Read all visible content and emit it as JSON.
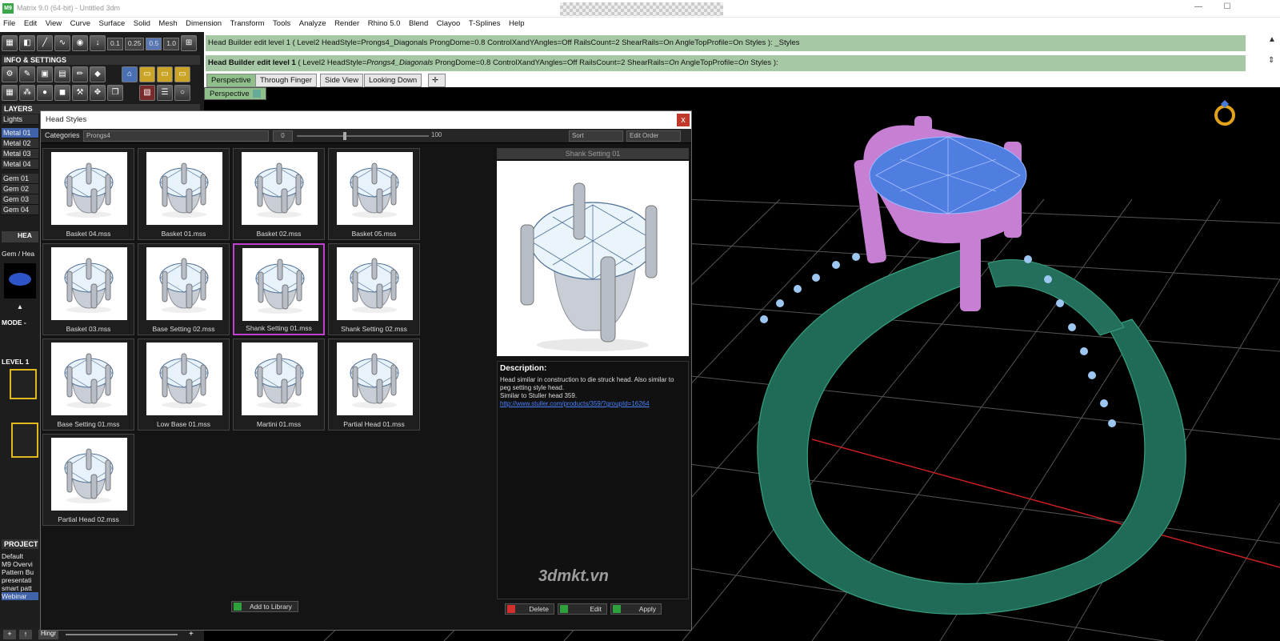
{
  "window": {
    "title": "Matrix 9.0 (64-bit) - Untitled 3dm",
    "minimize": "—",
    "maximize": "☐"
  },
  "menu": [
    "File",
    "Edit",
    "View",
    "Curve",
    "Surface",
    "Solid",
    "Mesh",
    "Dimension",
    "Transform",
    "Tools",
    "Analyze",
    "Render",
    "Rhino 5.0",
    "Blend",
    "Clayoo",
    "T-Splines",
    "Help"
  ],
  "toolbar": {
    "snaps": [
      "0.1",
      "0.25",
      "0.5",
      "1.0"
    ]
  },
  "left": {
    "info_header": "INFO & SETTINGS",
    "layers_header": "LAYERS",
    "layers": [
      "Lights",
      "Metal 01",
      "Metal 02",
      "Metal 03",
      "Metal 04",
      "Gem 01",
      "Gem 02",
      "Gem 03",
      "Gem 04"
    ],
    "head_label": "HEA",
    "gem_label": "Gem / Hea",
    "mode_label": "MODE -",
    "level_label": "LEVEL 1",
    "project_header": "PROJECT",
    "projects": [
      "Default",
      "M9 Overvi",
      "Pattern Bu",
      "presentati",
      "smart patt",
      "Webinar"
    ],
    "bottom_label": "Hingr"
  },
  "command": {
    "line1": "Head Builder edit level 1 ( Level2  HeadStyle=Prongs4_Diagonals  ProngDome=0.8  ControlXandYAngles=Off  RailsCount=2  ShearRails=On  AngleTopProfile=On  Styles ): _Styles",
    "line2_bold": "Head Builder edit level 1",
    "line2_a": " ( Level2  HeadStyle=",
    "line2_b": "Prongs4_Diagonals",
    "line2_c": "  ProngDome=0.8  ControlXandYAngles=Off  RailsCount=2  ShearRails=",
    "line2_d": "On",
    "line2_e": "  AngleTopProfile=",
    "line2_f": "On",
    "line2_g": "  Styles ):"
  },
  "viewtabs": [
    "Perspective",
    "Through Finger",
    "Side View",
    "Looking Down"
  ],
  "viewport": {
    "label": "Perspective"
  },
  "dialog": {
    "title": "Head Styles",
    "close": "x",
    "categories_label": "Categories",
    "category_value": "Prongs4",
    "slider_min": "0",
    "slider_max": "100",
    "sort": "Sort",
    "edit_order": "Edit Order",
    "thumbs": [
      "Basket 04.mss",
      "Basket 01.mss",
      "Basket 02.mss",
      "Basket 05.mss",
      "Basket 03.mss",
      "Base Setting 02.mss",
      "Shank Setting 01.mss",
      "Shank Setting 02.mss",
      "Base Setting 01.mss",
      "Low Base 01.mss",
      "Martini 01.mss",
      "Partial Head 01.mss",
      "Partial Head 02.mss"
    ],
    "selected_thumb": "Shank Setting 01.mss",
    "preview_title": "Shank Setting 01",
    "description_title": "Description:",
    "description_text": "Head similar in construction to die struck head.  Also similar to peg setting style head.",
    "description_text2": "Similar to Stuller head 359.",
    "description_link": "http://www.stuller.com/products/359/?groupId=16264",
    "watermark": "3dmkt.vn",
    "add_to_library": "Add to Library",
    "delete": "Delete",
    "edit": "Edit",
    "apply": "Apply"
  },
  "colors": {
    "command_bg": "#a7c8a5",
    "selection": "#c13fd1",
    "ring_band": "#1f6b58",
    "prongs": "#c77fd4",
    "gem": "#4f7de0",
    "grid": "#555555",
    "axis": "#cc2020"
  }
}
